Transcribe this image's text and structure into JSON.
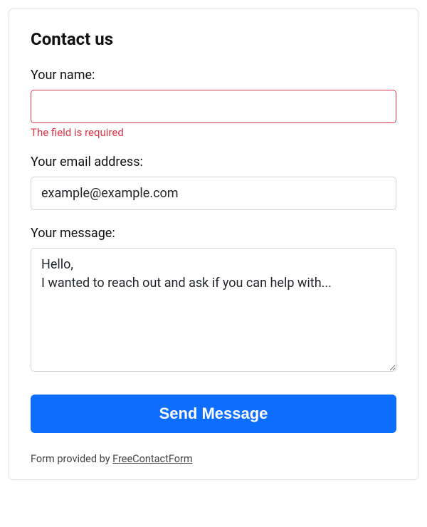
{
  "form": {
    "title": "Contact us",
    "fields": {
      "name": {
        "label": "Your name:",
        "value": "",
        "error": "The field is required"
      },
      "email": {
        "label": "Your email address:",
        "value": "example@example.com"
      },
      "message": {
        "label": "Your message:",
        "value": "Hello,\nI wanted to reach out and ask if you can help with..."
      }
    },
    "submit_label": "Send Message",
    "footer_prefix": "Form provided by ",
    "footer_link_text": "FreeContactForm"
  }
}
